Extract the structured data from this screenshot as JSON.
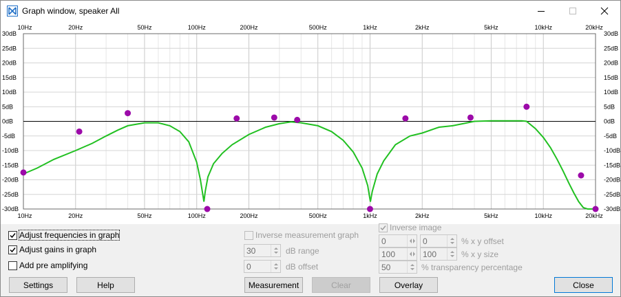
{
  "window": {
    "title": "Graph window, speaker All"
  },
  "chart_data": {
    "type": "line",
    "xscale": "log",
    "xlim": [
      10,
      20000
    ],
    "ylim": [
      -30,
      30
    ],
    "grid": true,
    "x_ticks": [
      {
        "v": 10,
        "label": "10Hz"
      },
      {
        "v": 20,
        "label": "20Hz"
      },
      {
        "v": 50,
        "label": "50Hz"
      },
      {
        "v": 100,
        "label": "100Hz"
      },
      {
        "v": 200,
        "label": "200Hz"
      },
      {
        "v": 500,
        "label": "500Hz"
      },
      {
        "v": 1000,
        "label": "1kHz"
      },
      {
        "v": 2000,
        "label": "2kHz"
      },
      {
        "v": 5000,
        "label": "5kHz"
      },
      {
        "v": 10000,
        "label": "10kHz"
      },
      {
        "v": 20000,
        "label": "20kHz"
      }
    ],
    "y_ticks": [
      {
        "v": 30,
        "label": "30dB"
      },
      {
        "v": 25,
        "label": "25dB"
      },
      {
        "v": 20,
        "label": "20dB"
      },
      {
        "v": 15,
        "label": "15dB"
      },
      {
        "v": 10,
        "label": "10dB"
      },
      {
        "v": 5,
        "label": "5dB"
      },
      {
        "v": 0,
        "label": "0dB"
      },
      {
        "v": -5,
        "label": "-5dB"
      },
      {
        "v": -10,
        "label": "-10dB"
      },
      {
        "v": -15,
        "label": "-15dB"
      },
      {
        "v": -20,
        "label": "-20dB"
      },
      {
        "v": -25,
        "label": "-25dB"
      },
      {
        "v": -30,
        "label": "-30dB"
      }
    ],
    "response_curve": {
      "color": "#21c021",
      "x": [
        10,
        12,
        15,
        20,
        25,
        30,
        35,
        40,
        50,
        60,
        70,
        80,
        90,
        100,
        105,
        109,
        110,
        112,
        116,
        125,
        140,
        160,
        200,
        250,
        300,
        350,
        400,
        500,
        600,
        700,
        800,
        900,
        970,
        995,
        1005,
        1030,
        1100,
        1200,
        1400,
        1700,
        2000,
        2500,
        3000,
        3500,
        4000,
        5000,
        6000,
        7000,
        7500,
        8000,
        9000,
        10000,
        11000,
        12000,
        13000,
        14000,
        15000,
        16000,
        17000,
        18000,
        19000,
        20000
      ],
      "y": [
        -18,
        -16,
        -13,
        -10,
        -7.5,
        -5,
        -3,
        -1.5,
        -0.5,
        -0.5,
        -1.5,
        -3.5,
        -7,
        -14,
        -20,
        -26,
        -27.5,
        -24,
        -19,
        -14.5,
        -11,
        -8,
        -4.5,
        -2,
        -0.8,
        -0.2,
        -0.5,
        -1.5,
        -3.5,
        -6.5,
        -10.5,
        -16,
        -22,
        -26,
        -27.5,
        -24,
        -18,
        -13.5,
        -8,
        -5,
        -4,
        -2,
        -1.5,
        -0.7,
        0,
        0.2,
        0.2,
        0.2,
        0.2,
        0,
        -2.5,
        -5.5,
        -9,
        -13,
        -17,
        -21,
        -24.5,
        -27.5,
        -29.5,
        -30,
        -30,
        -30
      ]
    },
    "measurement_points": {
      "color": "#9c0aa9",
      "x": [
        10,
        21,
        40,
        115,
        170,
        280,
        380,
        1000,
        1600,
        3800,
        8000,
        16500,
        20000
      ],
      "y": [
        -17.5,
        -3.5,
        2.8,
        -30,
        1,
        1.3,
        0.5,
        -30,
        1,
        1.3,
        5,
        -18.5,
        -30
      ]
    }
  },
  "controls": {
    "adjust_frequencies": {
      "label": "Adjust frequencies in graph",
      "checked": true
    },
    "adjust_gains": {
      "label": "Adjust gains in graph",
      "checked": true
    },
    "add_pre_amplifying": {
      "label": "Add pre amplifying",
      "checked": false
    },
    "inverse_measurement": {
      "label": "Inverse measurement graph",
      "checked": false
    },
    "db_range": {
      "value": "30",
      "label": "dB range"
    },
    "db_offset": {
      "value": "0",
      "label": "dB offset"
    },
    "inverse_image": {
      "label": "Inverse image",
      "checked": true
    },
    "xy_offset": {
      "x": "0",
      "y": "0",
      "label": "% x y offset"
    },
    "xy_size": {
      "x": "100",
      "y": "100",
      "label": "% x y size"
    },
    "transparency": {
      "value": "50",
      "label": "% transparency percentage"
    }
  },
  "buttons": {
    "settings": "Settings",
    "help": "Help",
    "measurement": "Measurement",
    "clear": "Clear",
    "overlay": "Overlay",
    "close": "Close"
  }
}
